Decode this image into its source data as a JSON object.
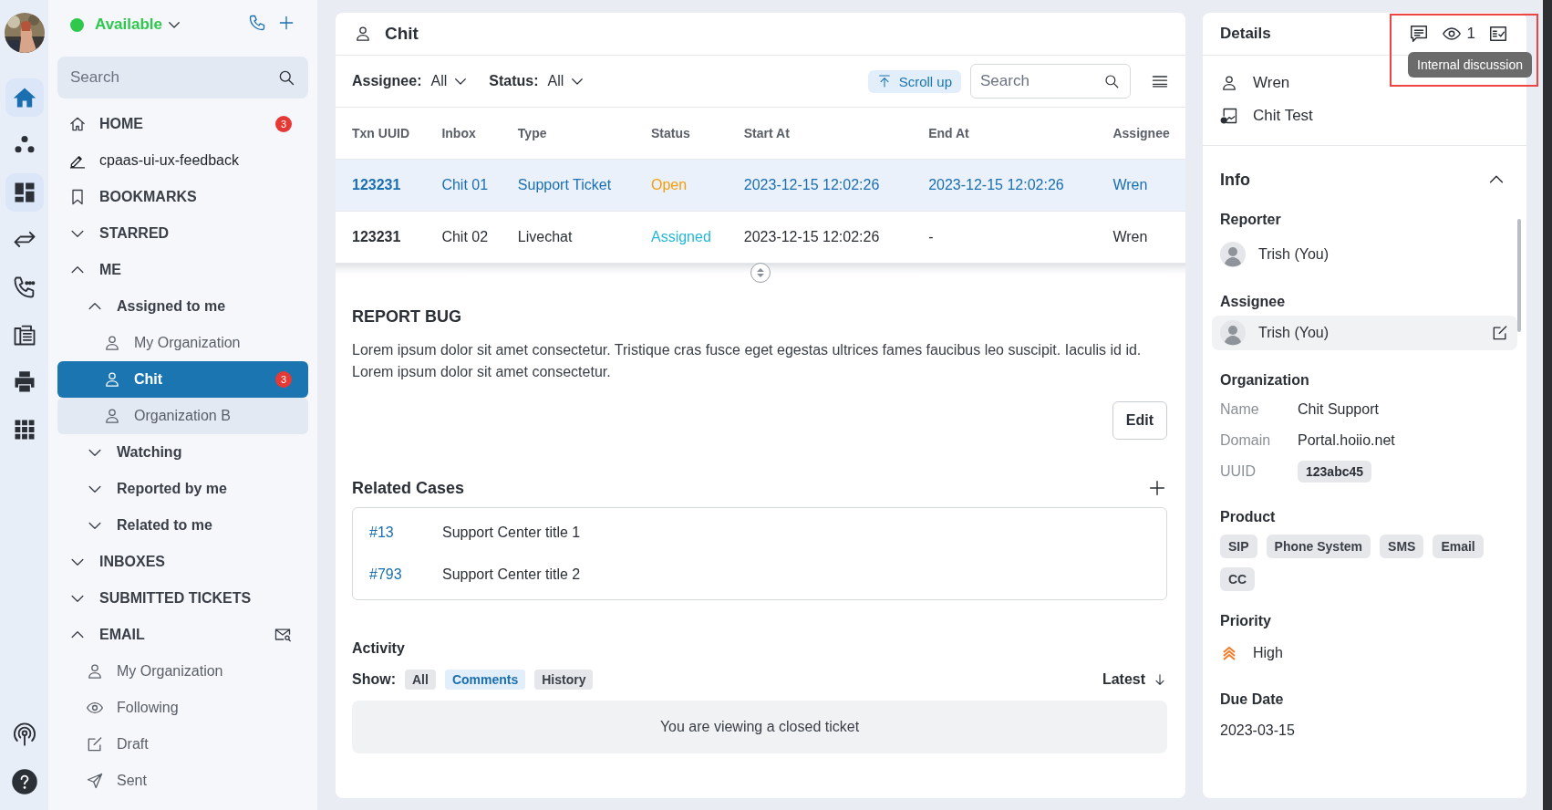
{
  "rail": {
    "top": [
      {
        "selected": true,
        "highlighted": true
      },
      {
        "selected": false,
        "highlighted": false
      },
      {
        "selected": false,
        "highlighted": true
      },
      {
        "selected": false,
        "highlighted": false
      },
      {
        "selected": false,
        "highlighted": false
      },
      {
        "selected": false,
        "highlighted": false
      },
      {
        "selected": false,
        "highlighted": false
      },
      {
        "selected": false,
        "highlighted": false
      }
    ],
    "bottom": [
      {
        "selected": false,
        "highlighted": false
      },
      {
        "selected": false,
        "highlighted": false
      }
    ]
  },
  "sidebar": {
    "status": "Available",
    "search": {
      "placeholder": "Search"
    },
    "items": [
      {
        "kind": "home",
        "label": "HOME",
        "badge": "3"
      },
      {
        "kind": "channel",
        "label": "cpaas-ui-ux-feedback"
      },
      {
        "kind": "bookmarks",
        "label": "BOOKMARKS"
      },
      {
        "kind": "group",
        "label": "STARRED",
        "expanded": false
      },
      {
        "kind": "group",
        "label": "ME",
        "expanded": true,
        "children": [
          {
            "kind": "group",
            "label": "Assigned to me",
            "expanded": true,
            "children": [
              {
                "kind": "queue",
                "label": "My Organization",
                "selected": false,
                "hovered": false
              },
              {
                "kind": "queue",
                "label": "Chit",
                "badge": "3",
                "selected": true,
                "hovered": false
              },
              {
                "kind": "queue",
                "label": "Organization B",
                "selected": false,
                "hovered": true
              }
            ]
          },
          {
            "kind": "group",
            "label": "Watching",
            "expanded": false
          },
          {
            "kind": "group",
            "label": "Reported by me",
            "expanded": false
          },
          {
            "kind": "group",
            "label": "Related to me",
            "expanded": false
          }
        ]
      },
      {
        "kind": "group",
        "label": "INBOXES",
        "expanded": false
      },
      {
        "kind": "group",
        "label": "SUBMITTED TICKETS",
        "expanded": false
      },
      {
        "kind": "email",
        "label": "EMAIL",
        "expanded": true,
        "children": [
          {
            "kind": "queue",
            "label": "My Organization"
          },
          {
            "kind": "following",
            "label": "Following"
          },
          {
            "kind": "draft",
            "label": "Draft"
          },
          {
            "kind": "sent",
            "label": "Sent"
          }
        ]
      }
    ]
  },
  "main": {
    "title": "Chit",
    "filters": [
      {
        "label": "Assignee:",
        "value": "All"
      },
      {
        "label": "Status:",
        "value": "All"
      }
    ],
    "scroll_up": "Scroll up",
    "search": {
      "placeholder": "Search"
    },
    "table": {
      "columns": [
        "Txn UUID",
        "Inbox",
        "Type",
        "Status",
        "Start At",
        "End At",
        "Assignee"
      ],
      "rows": [
        {
          "cells": [
            "123231",
            "Chit 01",
            "Support Ticket",
            "Open",
            "2023-12-15 12:02:26",
            "2023-12-15 12:02:26",
            "Wren"
          ],
          "color": "#f59e0b",
          "selected": true
        },
        {
          "cells": [
            "123231",
            "Chit 02",
            "Livechat",
            "Assigned",
            "2023-12-15 12:02:26",
            "-",
            "Wren"
          ],
          "color": "#22b8d6",
          "selected": false
        }
      ]
    },
    "report": {
      "title": "REPORT BUG",
      "paragraphs": [
        "Lorem ipsum dolor sit amet consectetur. Tristique cras fusce eget egestas ultrices fames faucibus leo suscipit. Iaculis id id.",
        "Lorem ipsum dolor sit amet consectetur."
      ],
      "edit": "Edit"
    },
    "related": {
      "title": "Related Cases",
      "cases": [
        {
          "id": "#13",
          "title": "Support Center title 1"
        },
        {
          "id": "#793",
          "title": "Support Center title 2"
        }
      ]
    },
    "activity": {
      "title": "Activity",
      "show_label": "Show:",
      "filters": [
        {
          "label": "All",
          "selected": false
        },
        {
          "label": "Comments",
          "selected": true
        },
        {
          "label": "History",
          "selected": false
        }
      ],
      "sort": "Latest",
      "notice": "You are viewing a closed ticket"
    }
  },
  "details": {
    "title": "Details",
    "watchers": "1",
    "tooltip": "Internal discussion",
    "assignee": "Wren",
    "inbox": "Chit Test",
    "info": {
      "title": "Info",
      "expanded": true,
      "reporter_label": "Reporter",
      "reporter": "Trish (You)",
      "assignee_label": "Assignee",
      "assignee": "Trish (You)",
      "organization_label": "Organization",
      "fields": [
        {
          "label": "Name",
          "value": "Chit Support",
          "kind": "text"
        },
        {
          "label": "Domain",
          "value": "Portal.hoiio.net",
          "kind": "text"
        },
        {
          "label": "UUID",
          "value": "123abc45",
          "kind": "chip"
        }
      ],
      "product_label": "Product",
      "products": [
        "SIP",
        "Phone System",
        "SMS",
        "Email",
        "CC"
      ],
      "priority_label": "Priority",
      "priority": "High",
      "due_label": "Due Date",
      "due": "2023-03-15"
    }
  }
}
